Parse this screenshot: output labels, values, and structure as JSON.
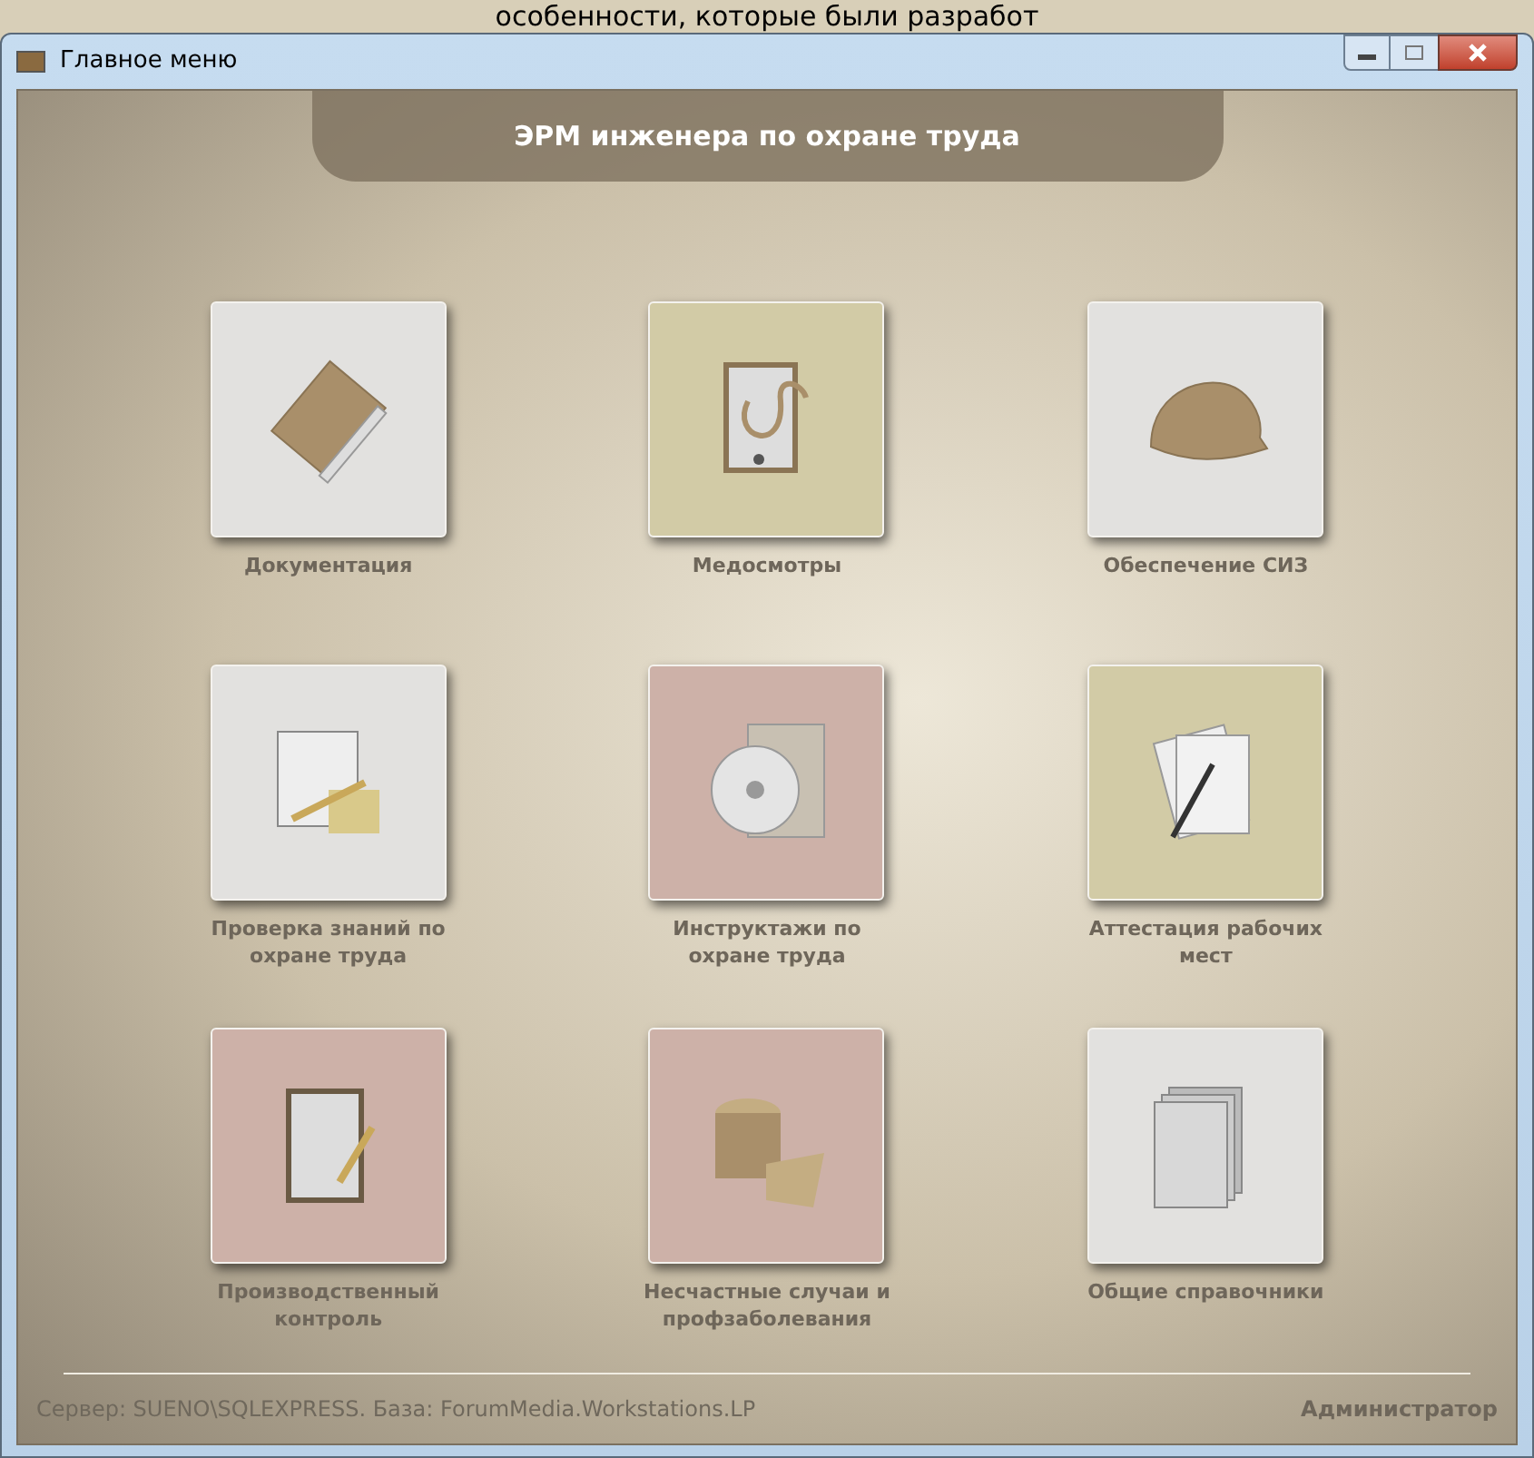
{
  "background_text": "особенности, которые были разработ",
  "window": {
    "title": "Главное меню"
  },
  "header": "ЭРМ инженера по охране труда",
  "tiles": [
    {
      "label": "Документация",
      "kind": "document",
      "color": "#e2e1df"
    },
    {
      "label": "Медосмотры",
      "kind": "stethoscope",
      "color": "#d2cba6"
    },
    {
      "label": "Обеспечение СИЗ",
      "kind": "helmet",
      "color": "#e2e1df"
    },
    {
      "label": "Проверка знаний по охране труда",
      "kind": "notepad",
      "color": "#e2e1df"
    },
    {
      "label": "Инструктажи по охране труда",
      "kind": "disc",
      "color": "#cdb1a8"
    },
    {
      "label": "Аттестация рабочих мест",
      "kind": "papers",
      "color": "#d2cba6"
    },
    {
      "label": "Производственный контроль",
      "kind": "clipboard",
      "color": "#cdb1a8"
    },
    {
      "label": "Несчастные случаи и профзаболевания",
      "kind": "bandage",
      "color": "#cdb1a8"
    },
    {
      "label": "Общие справочники",
      "kind": "stack",
      "color": "#e2e1df"
    }
  ],
  "status_bar": {
    "connection": "Сервер: SUENO\\SQLEXPRESS. База: ForumMedia.Workstations.LP",
    "user": "Администратор"
  }
}
